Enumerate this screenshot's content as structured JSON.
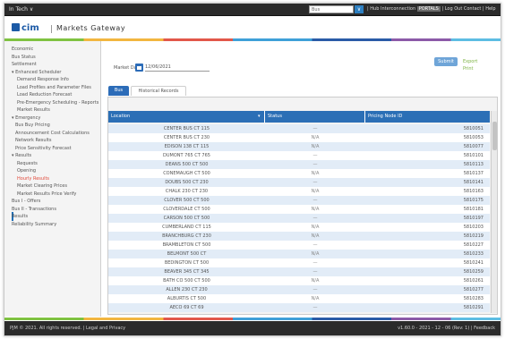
{
  "topbar": {
    "menu_label": "In Tech ∨",
    "search_placeholder": "Bus",
    "search_button": "∨",
    "user_text": "| Hub Interconnection",
    "user_highlight": "PORTALS",
    "links": "| Log Out   Contact | Help"
  },
  "header": {
    "logo_text": "cim",
    "title": "Markets Gateway"
  },
  "sidebar": {
    "items": [
      {
        "label": "Economic",
        "active": false
      },
      {
        "label": "Bus Status",
        "active": false
      },
      {
        "label": "Settlement",
        "active": false
      },
      {
        "label": "▾ Enhanced Scheduler",
        "active": false
      },
      {
        "label": "Demand Response Info",
        "active": false
      },
      {
        "label": "Load Profiles and Parameter Files",
        "active": false
      },
      {
        "label": "Load Reduction Forecast",
        "active": false
      },
      {
        "label": "Pre-Emergency Scheduling - Reports",
        "active": false
      },
      {
        "label": "Market Results",
        "active": false
      },
      {
        "label": "▾ Emergency",
        "active": false
      },
      {
        "label": "Bus Buy Pricing",
        "active": false
      },
      {
        "label": "Announcement Cost Calculations",
        "active": false
      },
      {
        "label": "Network Results",
        "active": false
      },
      {
        "label": "Price Sensitivity Forecast",
        "active": false
      },
      {
        "label": "▾ Results",
        "active": false
      },
      {
        "label": "Requests",
        "active": false
      },
      {
        "label": "Opening",
        "active": false
      },
      {
        "label": "Hourly Results",
        "active": true
      },
      {
        "label": "Market Clearing Prices",
        "active": false
      },
      {
        "label": "Market Results Price Verify",
        "active": false
      },
      {
        "label": "Bus I - Offers",
        "active": false
      },
      {
        "label": "Bus II - Transactions",
        "active": false
      },
      {
        "label": "Results",
        "active": false
      },
      {
        "label": "Reliability Summary",
        "active": false
      }
    ]
  },
  "main": {
    "filter_label": "Market Day",
    "date_value": "12/06/2021",
    "action_button": "Submit",
    "side_links": [
      "Export",
      "Print"
    ],
    "tabs": [
      "Bus",
      "Historical Records"
    ],
    "columns": [
      "Location",
      "Status",
      "Pricing Node ID"
    ],
    "rows": [
      {
        "location": "CENTER BUS CT 115",
        "status": "—",
        "node": "5810051"
      },
      {
        "location": "CENTER BUS CT 230",
        "status": "N/A",
        "node": "5810053"
      },
      {
        "location": "EDISON 138 CT 115",
        "status": "N/A",
        "node": "5810077"
      },
      {
        "location": "DUMONT 765 CT 765",
        "status": "—",
        "node": "5810101"
      },
      {
        "location": "DEANS 500 CT 500",
        "status": "—",
        "node": "5810113"
      },
      {
        "location": "CONEMAUGH CT 500",
        "status": "N/A",
        "node": "5810137"
      },
      {
        "location": "DOUBS 500 CT 230",
        "status": "—",
        "node": "5810141"
      },
      {
        "location": "CHALK 230 CT 230",
        "status": "N/A",
        "node": "5810163"
      },
      {
        "location": "CLOVER 500 CT 500",
        "status": "—",
        "node": "5810175"
      },
      {
        "location": "CLOVERDALE CT 500",
        "status": "N/A",
        "node": "5810181"
      },
      {
        "location": "CARSON 500 CT 500",
        "status": "—",
        "node": "5810197"
      },
      {
        "location": "CUMBERLAND CT 115",
        "status": "N/A",
        "node": "5810203"
      },
      {
        "location": "BRANCHBURG CT 230",
        "status": "N/A",
        "node": "5810219"
      },
      {
        "location": "BRAMBLETON CT 500",
        "status": "—",
        "node": "5810227"
      },
      {
        "location": "BELMONT 500 CT",
        "status": "N/A",
        "node": "5810233"
      },
      {
        "location": "BEDINGTON CT 500",
        "status": "—",
        "node": "5810241"
      },
      {
        "location": "BEAVER 345 CT 345",
        "status": "—",
        "node": "5810259"
      },
      {
        "location": "BATH CO 500 CT 500",
        "status": "N/A",
        "node": "5810261"
      },
      {
        "location": "ALLEN 230 CT 230",
        "status": "—",
        "node": "5810277"
      },
      {
        "location": "ALBURTIS CT 500",
        "status": "N/A",
        "node": "5810283"
      },
      {
        "location": "AECO 69 CT 69",
        "status": "—",
        "node": "5810291"
      }
    ]
  },
  "footer": {
    "left": "PJM © 2021. All rights reserved. | Legal and Privacy",
    "right": "v1.60.0 - 2021 - 12 - 06 (Rev: 1) | Feedback"
  },
  "colors": {
    "accent": "#2c6cb8",
    "active_sidebar": "#e24a3b",
    "row_stripe": "#e2ecf7"
  }
}
